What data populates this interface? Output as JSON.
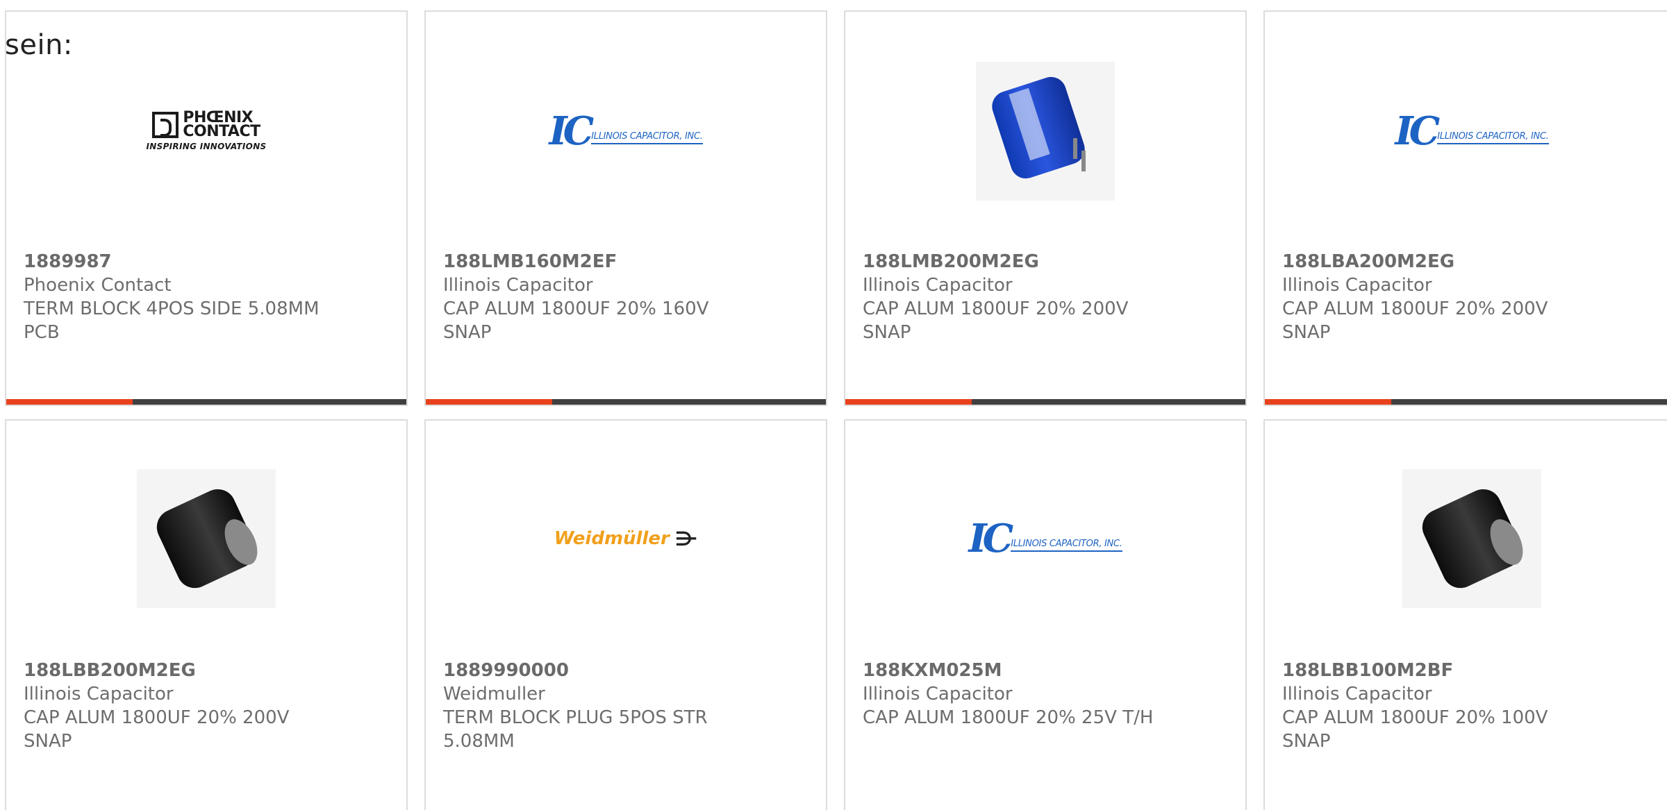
{
  "intro_text": "sein:",
  "cards": [
    {
      "part_number": "1889987",
      "manufacturer": "Phoenix Contact",
      "description_line1": "TERM BLOCK 4POS SIDE 5.08MM",
      "description_line2": "PCB",
      "image": "phoenix-contact-logo",
      "logo": {
        "line1": "PHŒNIX",
        "line2": "CONTACT",
        "tagline": "INSPIRING INNOVATIONS"
      }
    },
    {
      "part_number": "188LMB160M2EF",
      "manufacturer": "Illinois Capacitor",
      "description_line1": "CAP ALUM 1800UF 20% 160V",
      "description_line2": "SNAP",
      "image": "illinois-capacitor-logo",
      "logo": {
        "mark": "IC",
        "text": "ILLINOIS CAPACITOR, INC."
      }
    },
    {
      "part_number": "188LMB200M2EG",
      "manufacturer": "Illinois Capacitor",
      "description_line1": "CAP ALUM 1800UF 20% 200V",
      "description_line2": "SNAP",
      "image": "blue-capacitor-photo"
    },
    {
      "part_number": "188LBA200M2EG",
      "manufacturer": "Illinois Capacitor",
      "description_line1": "CAP ALUM 1800UF 20% 200V",
      "description_line2": "SNAP",
      "image": "illinois-capacitor-logo",
      "logo": {
        "mark": "IC",
        "text": "ILLINOIS CAPACITOR, INC."
      }
    },
    {
      "part_number": "188LBB200M2EG",
      "manufacturer": "Illinois Capacitor",
      "description_line1": "CAP ALUM 1800UF 20% 200V",
      "description_line2": "SNAP",
      "image": "black-capacitor-photo"
    },
    {
      "part_number": "1889990000",
      "manufacturer": "Weidmuller",
      "description_line1": "TERM BLOCK PLUG 5POS STR",
      "description_line2": "5.08MM",
      "image": "weidmuller-logo",
      "logo": {
        "text": "Weidmüller",
        "symbol": "⋺"
      }
    },
    {
      "part_number": "188KXM025M",
      "manufacturer": "Illinois Capacitor",
      "description_line1": "CAP ALUM 1800UF 20% 25V T/H",
      "description_line2": "",
      "image": "illinois-capacitor-logo",
      "logo": {
        "mark": "IC",
        "text": "ILLINOIS CAPACITOR, INC."
      }
    },
    {
      "part_number": "188LBB100M2BF",
      "manufacturer": "Illinois Capacitor",
      "description_line1": "CAP ALUM 1800UF 20% 100V",
      "description_line2": "SNAP",
      "image": "black-capacitor-photo"
    }
  ],
  "colors": {
    "accent": "#e8421c",
    "bar": "#404040",
    "text": "#6d6d6d",
    "ic_blue": "#1d63c3",
    "weidmuller_orange": "#f1a01c"
  }
}
